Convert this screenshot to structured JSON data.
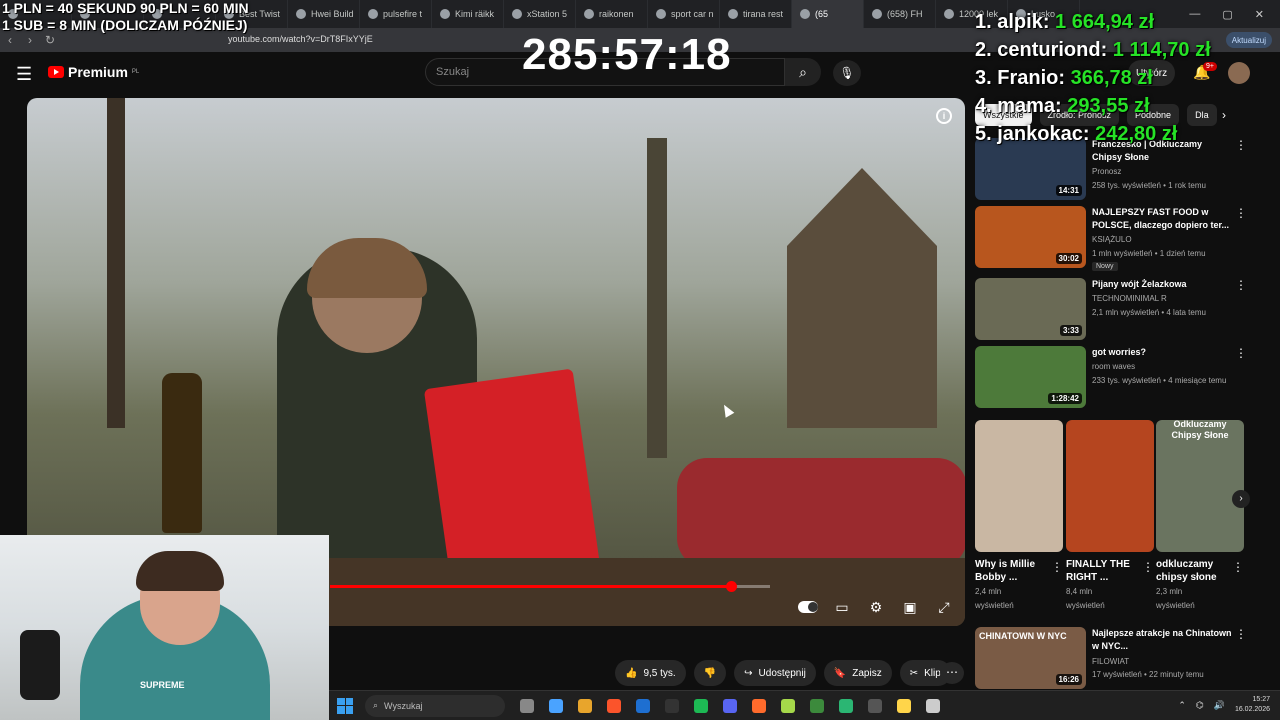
{
  "browser": {
    "tabs": [
      {
        "label": ""
      },
      {
        "label": ""
      },
      {
        "label": ""
      },
      {
        "label": "Best Twist"
      },
      {
        "label": "Hwei Build"
      },
      {
        "label": "pulsefire t"
      },
      {
        "label": "Kimi räikk"
      },
      {
        "label": "xStation 5"
      },
      {
        "label": "raikonen"
      },
      {
        "label": "sport car n"
      },
      {
        "label": "tirana rest"
      },
      {
        "label": "(65"
      },
      {
        "label": "(658) FH"
      },
      {
        "label": "12000 lek"
      },
      {
        "label": "Lusko"
      }
    ],
    "url": "youtube.com/watch?v=DrT8FIxYYjE",
    "update_label": "Aktualizuj",
    "window_controls": [
      "—",
      "▢",
      "✕"
    ]
  },
  "overlay": {
    "donation_line1": "1 PLN = 40 SEKUND 90 PLN = 60 MIN",
    "donation_line2": "1 SUB = 8 MIN (DOLICZAM PÓŹNIEJ)",
    "timer": "285:57:18",
    "leaderboard": [
      {
        "name": "1. alpik:",
        "amount": "1 664,94 zł"
      },
      {
        "name": "2. centuriond:",
        "amount": "1 114,70 zł"
      },
      {
        "name": "3. Franio:",
        "amount": "366,78 zł"
      },
      {
        "name": "4. mama:",
        "amount": "293,55 zł"
      },
      {
        "name": "5. jankokac:",
        "amount": "242,80 zł"
      }
    ]
  },
  "youtube": {
    "logo_text": "Premium",
    "logo_region": "PL",
    "search_placeholder": "Szukaj",
    "create_label": "Utwórz",
    "notifications_badge": "9+",
    "chips": [
      "Wszystkie",
      "Źródło: Pronosz",
      "Podobne",
      "Dla"
    ],
    "actions": {
      "likes": "9,5 tys.",
      "share": "Udostępnij",
      "save": "Zapisz",
      "clip": "Klip"
    },
    "progress_fraction": 0.91,
    "recommendations": [
      {
        "title": "Franczesko | Odkluczamy Chipsy Słone",
        "channel": "Pronosz",
        "meta": "258 tys. wyświetleń • 1 rok temu",
        "duration": "14:31",
        "color": "#2a3a52"
      },
      {
        "title": "NAJLEPSZY FAST FOOD w POLSCE, dlaczego dopiero ter...",
        "channel": "KSIĄŻULO",
        "meta": "1 mln wyświetleń • 1 dzień temu",
        "duration": "30:02",
        "color": "#b8561e",
        "badge": "Nowy"
      },
      {
        "title": "Pijany wójt Żelazkowa",
        "channel": "TECHNOMINIMAL R",
        "meta": "2,1 mln wyświetleń • 4 lata temu",
        "duration": "3:33",
        "color": "#6a6a55"
      },
      {
        "title": "got worries?",
        "channel": "room waves",
        "meta": "233 tys. wyświetleń • 4 miesiące temu",
        "duration": "1:28:42",
        "color": "#4d7a3a"
      }
    ],
    "shorts": [
      {
        "title": "Why is Millie Bobby ...",
        "views": "2,4 mln",
        "views2": "wyświetleń",
        "color": "#c9b7a3"
      },
      {
        "title": "FINALLY THE RIGHT ...",
        "views": "8,4 mln",
        "views2": "wyświetleń",
        "color": "#b5451f"
      },
      {
        "title": "odkluczamy chipsy słone",
        "views": "2,3 mln",
        "views2": "wyświetleń",
        "color": "#6a7460",
        "caption": "Odkluczamy Chipsy Słone"
      }
    ],
    "last_rec": {
      "title": "Najlepsze atrakcje na Chinatown w NYC...",
      "channel": "FILOWIAT",
      "meta": "17 wyświetleń • 22 minuty temu",
      "duration": "16:26",
      "color": "#7a5b45",
      "thumb_text": "CHINATOWN W NYC"
    }
  },
  "webcam": {
    "shirt_text": "SUPREME"
  },
  "taskbar": {
    "search_placeholder": "Wyszukaj",
    "time": "15:27",
    "date": "16.02.2026",
    "icon_colors": [
      "#888",
      "#4aa3ff",
      "#e8a52c",
      "#fb542b",
      "#1e6fd1",
      "#333",
      "#1db954",
      "#5865f2",
      "#ff6b2c",
      "#a5d84a",
      "#3c8a3c",
      "#2bb673",
      "#555",
      "#ffd54a",
      "#ccc"
    ]
  }
}
